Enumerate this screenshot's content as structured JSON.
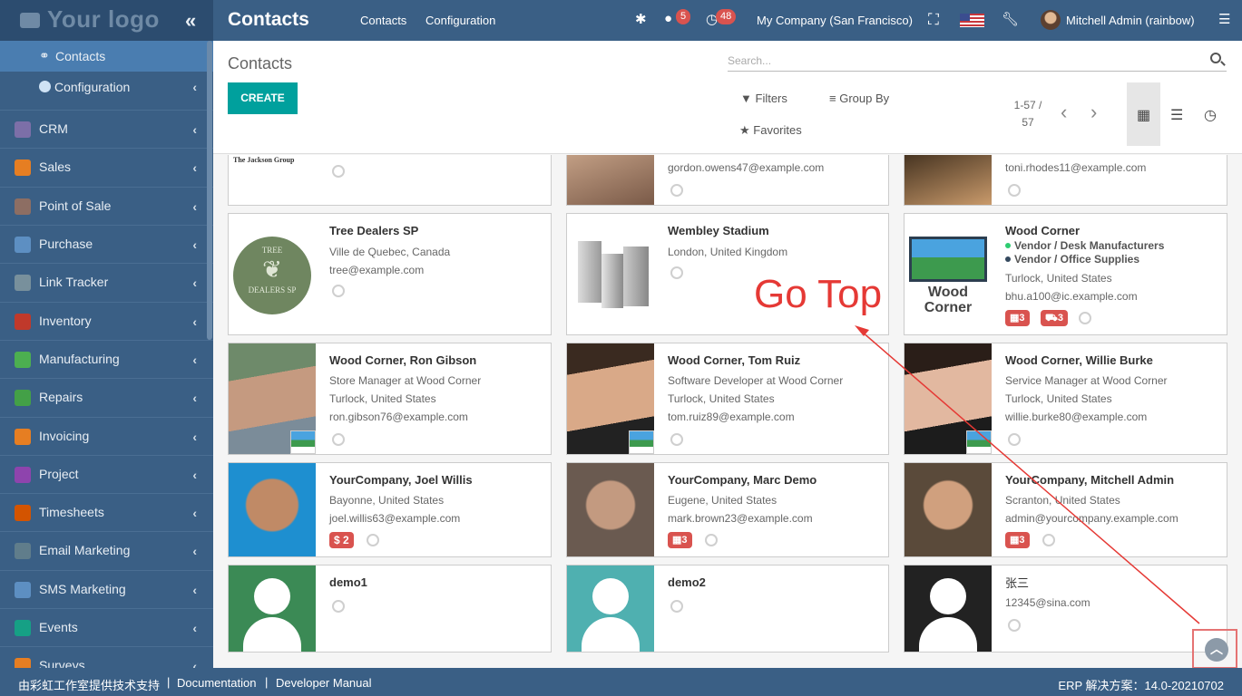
{
  "logo": {
    "text": "Your logo"
  },
  "header": {
    "title": "Contacts",
    "menu": [
      "Contacts",
      "Configuration"
    ],
    "messages_badge": "5",
    "activities_badge": "48",
    "company": "My Company (San Francisco)",
    "user": "Mitchell Admin (rainbow)"
  },
  "sidebar": {
    "sub": [
      {
        "label": "Contacts"
      },
      {
        "label": "Configuration"
      }
    ],
    "items": [
      {
        "label": "CRM",
        "color": "#7c6fa8"
      },
      {
        "label": "Sales",
        "color": "#e67e22"
      },
      {
        "label": "Point of Sale",
        "color": "#8d6e63"
      },
      {
        "label": "Purchase",
        "color": "#5d8fc2"
      },
      {
        "label": "Link Tracker",
        "color": "#78909c"
      },
      {
        "label": "Inventory",
        "color": "#c0392b"
      },
      {
        "label": "Manufacturing",
        "color": "#4caf50"
      },
      {
        "label": "Repairs",
        "color": "#43a047"
      },
      {
        "label": "Invoicing",
        "color": "#e67e22"
      },
      {
        "label": "Project",
        "color": "#8e44ad"
      },
      {
        "label": "Timesheets",
        "color": "#d35400"
      },
      {
        "label": "Email Marketing",
        "color": "#607d8b"
      },
      {
        "label": "SMS Marketing",
        "color": "#5d8fc2"
      },
      {
        "label": "Events",
        "color": "#16a085"
      },
      {
        "label": "Surveys",
        "color": "#e67e22"
      }
    ]
  },
  "control": {
    "breadcrumb": "Contacts",
    "create_label": "CREATE",
    "search_placeholder": "Search...",
    "filters": "Filters",
    "group_by": "Group By",
    "favorites": "Favorites",
    "pager_top": "1-57 /",
    "pager_bottom": "57"
  },
  "cards": {
    "c0": {
      "name": "",
      "line1": "",
      "brand": "The Jackson Group"
    },
    "c1": {
      "email": "gordon.owens47@example.com"
    },
    "c2": {
      "email": "toni.rhodes11@example.com"
    },
    "c3": {
      "name": "Tree Dealers SP",
      "line1": "Ville de Quebec, Canada",
      "line2": "tree@example.com",
      "logo1": "TREE",
      "logo2": "DEALERS SP"
    },
    "c4": {
      "name": "Wembley Stadium",
      "line1": "London, United Kingdom"
    },
    "c5": {
      "name": "Wood Corner",
      "tag1": "Vendor / Desk Manufacturers",
      "tag2": "Vendor / Office Supplies",
      "line1": "Turlock, United States",
      "line2": "bhu.a100@ic.example.com",
      "badge1": "3",
      "badge2": "3",
      "logo1": "Wood",
      "logo2": "Corner"
    },
    "c6": {
      "name": "Wood Corner, Ron Gibson",
      "line1": "Store Manager at Wood Corner",
      "line2": "Turlock, United States",
      "line3": "ron.gibson76@example.com"
    },
    "c7": {
      "name": "Wood Corner, Tom Ruiz",
      "line1": "Software Developer at Wood Corner",
      "line2": "Turlock, United States",
      "line3": "tom.ruiz89@example.com"
    },
    "c8": {
      "name": "Wood Corner, Willie Burke",
      "line1": "Service Manager at Wood Corner",
      "line2": "Turlock, United States",
      "line3": "willie.burke80@example.com"
    },
    "c9": {
      "name": "YourCompany, Joel Willis",
      "line1": "Bayonne, United States",
      "line2": "joel.willis63@example.com",
      "badge1": "$ 2"
    },
    "c10": {
      "name": "YourCompany, Marc Demo",
      "line1": "Eugene, United States",
      "line2": "mark.brown23@example.com",
      "badge1": "3"
    },
    "c11": {
      "name": "YourCompany, Mitchell Admin",
      "line1": "Scranton, United States",
      "line2": "admin@yourcompany.example.com",
      "badge1": "3"
    },
    "c12": {
      "name": "demo1"
    },
    "c13": {
      "name": "demo2"
    },
    "c14": {
      "name": "张三",
      "line1": "12345@sina.com"
    }
  },
  "overlay": {
    "go_top": "Go Top"
  },
  "footer": {
    "support": "由彩虹工作室提供技术支持",
    "documentation": "Documentation",
    "developer_manual": "Developer Manual",
    "version": "ERP 解决方案：14.0-20210702"
  }
}
